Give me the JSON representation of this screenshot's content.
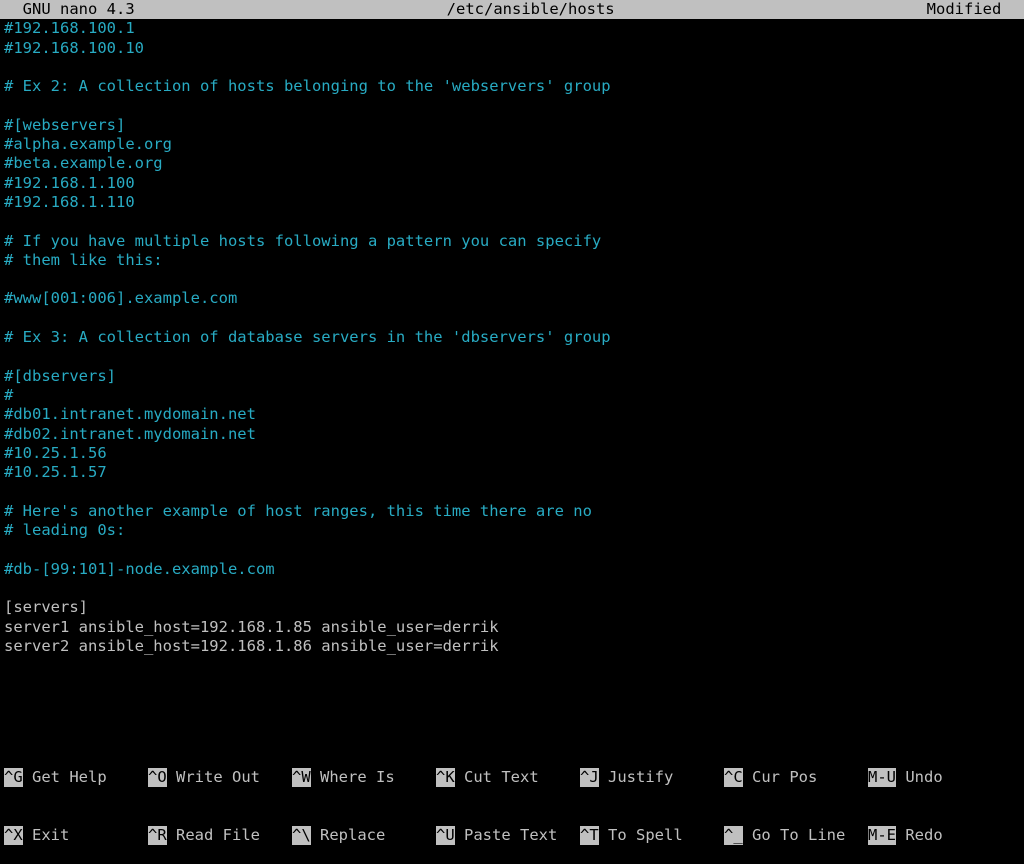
{
  "titlebar": {
    "left": "  GNU nano 4.3",
    "center": "/etc/ansible/hosts",
    "right": "Modified  "
  },
  "lines": [
    {
      "cls": "comment",
      "text": "#192.168.100.1"
    },
    {
      "cls": "comment",
      "text": "#192.168.100.10"
    },
    {
      "cls": "",
      "text": ""
    },
    {
      "cls": "comment",
      "text": "# Ex 2: A collection of hosts belonging to the 'webservers' group"
    },
    {
      "cls": "",
      "text": ""
    },
    {
      "cls": "comment",
      "text": "#[webservers]"
    },
    {
      "cls": "comment",
      "text": "#alpha.example.org"
    },
    {
      "cls": "comment",
      "text": "#beta.example.org"
    },
    {
      "cls": "comment",
      "text": "#192.168.1.100"
    },
    {
      "cls": "comment",
      "text": "#192.168.1.110"
    },
    {
      "cls": "",
      "text": ""
    },
    {
      "cls": "comment",
      "text": "# If you have multiple hosts following a pattern you can specify"
    },
    {
      "cls": "comment",
      "text": "# them like this:"
    },
    {
      "cls": "",
      "text": ""
    },
    {
      "cls": "comment",
      "text": "#www[001:006].example.com"
    },
    {
      "cls": "",
      "text": ""
    },
    {
      "cls": "comment",
      "text": "# Ex 3: A collection of database servers in the 'dbservers' group"
    },
    {
      "cls": "",
      "text": ""
    },
    {
      "cls": "comment",
      "text": "#[dbservers]"
    },
    {
      "cls": "comment",
      "text": "#"
    },
    {
      "cls": "comment",
      "text": "#db01.intranet.mydomain.net"
    },
    {
      "cls": "comment",
      "text": "#db02.intranet.mydomain.net"
    },
    {
      "cls": "comment",
      "text": "#10.25.1.56"
    },
    {
      "cls": "comment",
      "text": "#10.25.1.57"
    },
    {
      "cls": "",
      "text": ""
    },
    {
      "cls": "comment",
      "text": "# Here's another example of host ranges, this time there are no"
    },
    {
      "cls": "comment",
      "text": "# leading 0s:"
    },
    {
      "cls": "",
      "text": ""
    },
    {
      "cls": "comment",
      "text": "#db-[99:101]-node.example.com"
    },
    {
      "cls": "",
      "text": ""
    },
    {
      "cls": "",
      "text": "[servers]"
    },
    {
      "cls": "",
      "text": "server1 ansible_host=192.168.1.85 ansible_user=derrik"
    },
    {
      "cls": "",
      "text": "server2 ansible_host=192.168.1.86 ansible_user=derrik"
    }
  ],
  "shortcuts": {
    "row1": [
      {
        "key": "^G",
        "label": " Get Help"
      },
      {
        "key": "^O",
        "label": " Write Out"
      },
      {
        "key": "^W",
        "label": " Where Is"
      },
      {
        "key": "^K",
        "label": " Cut Text"
      },
      {
        "key": "^J",
        "label": " Justify"
      },
      {
        "key": "^C",
        "label": " Cur Pos"
      },
      {
        "key": "M-U",
        "label": " Undo"
      }
    ],
    "row2": [
      {
        "key": "^X",
        "label": " Exit"
      },
      {
        "key": "^R",
        "label": " Read File"
      },
      {
        "key": "^\\",
        "label": " Replace"
      },
      {
        "key": "^U",
        "label": " Paste Text"
      },
      {
        "key": "^T",
        "label": " To Spell"
      },
      {
        "key": "^_",
        "label": " Go To Line"
      },
      {
        "key": "M-E",
        "label": " Redo"
      }
    ]
  }
}
